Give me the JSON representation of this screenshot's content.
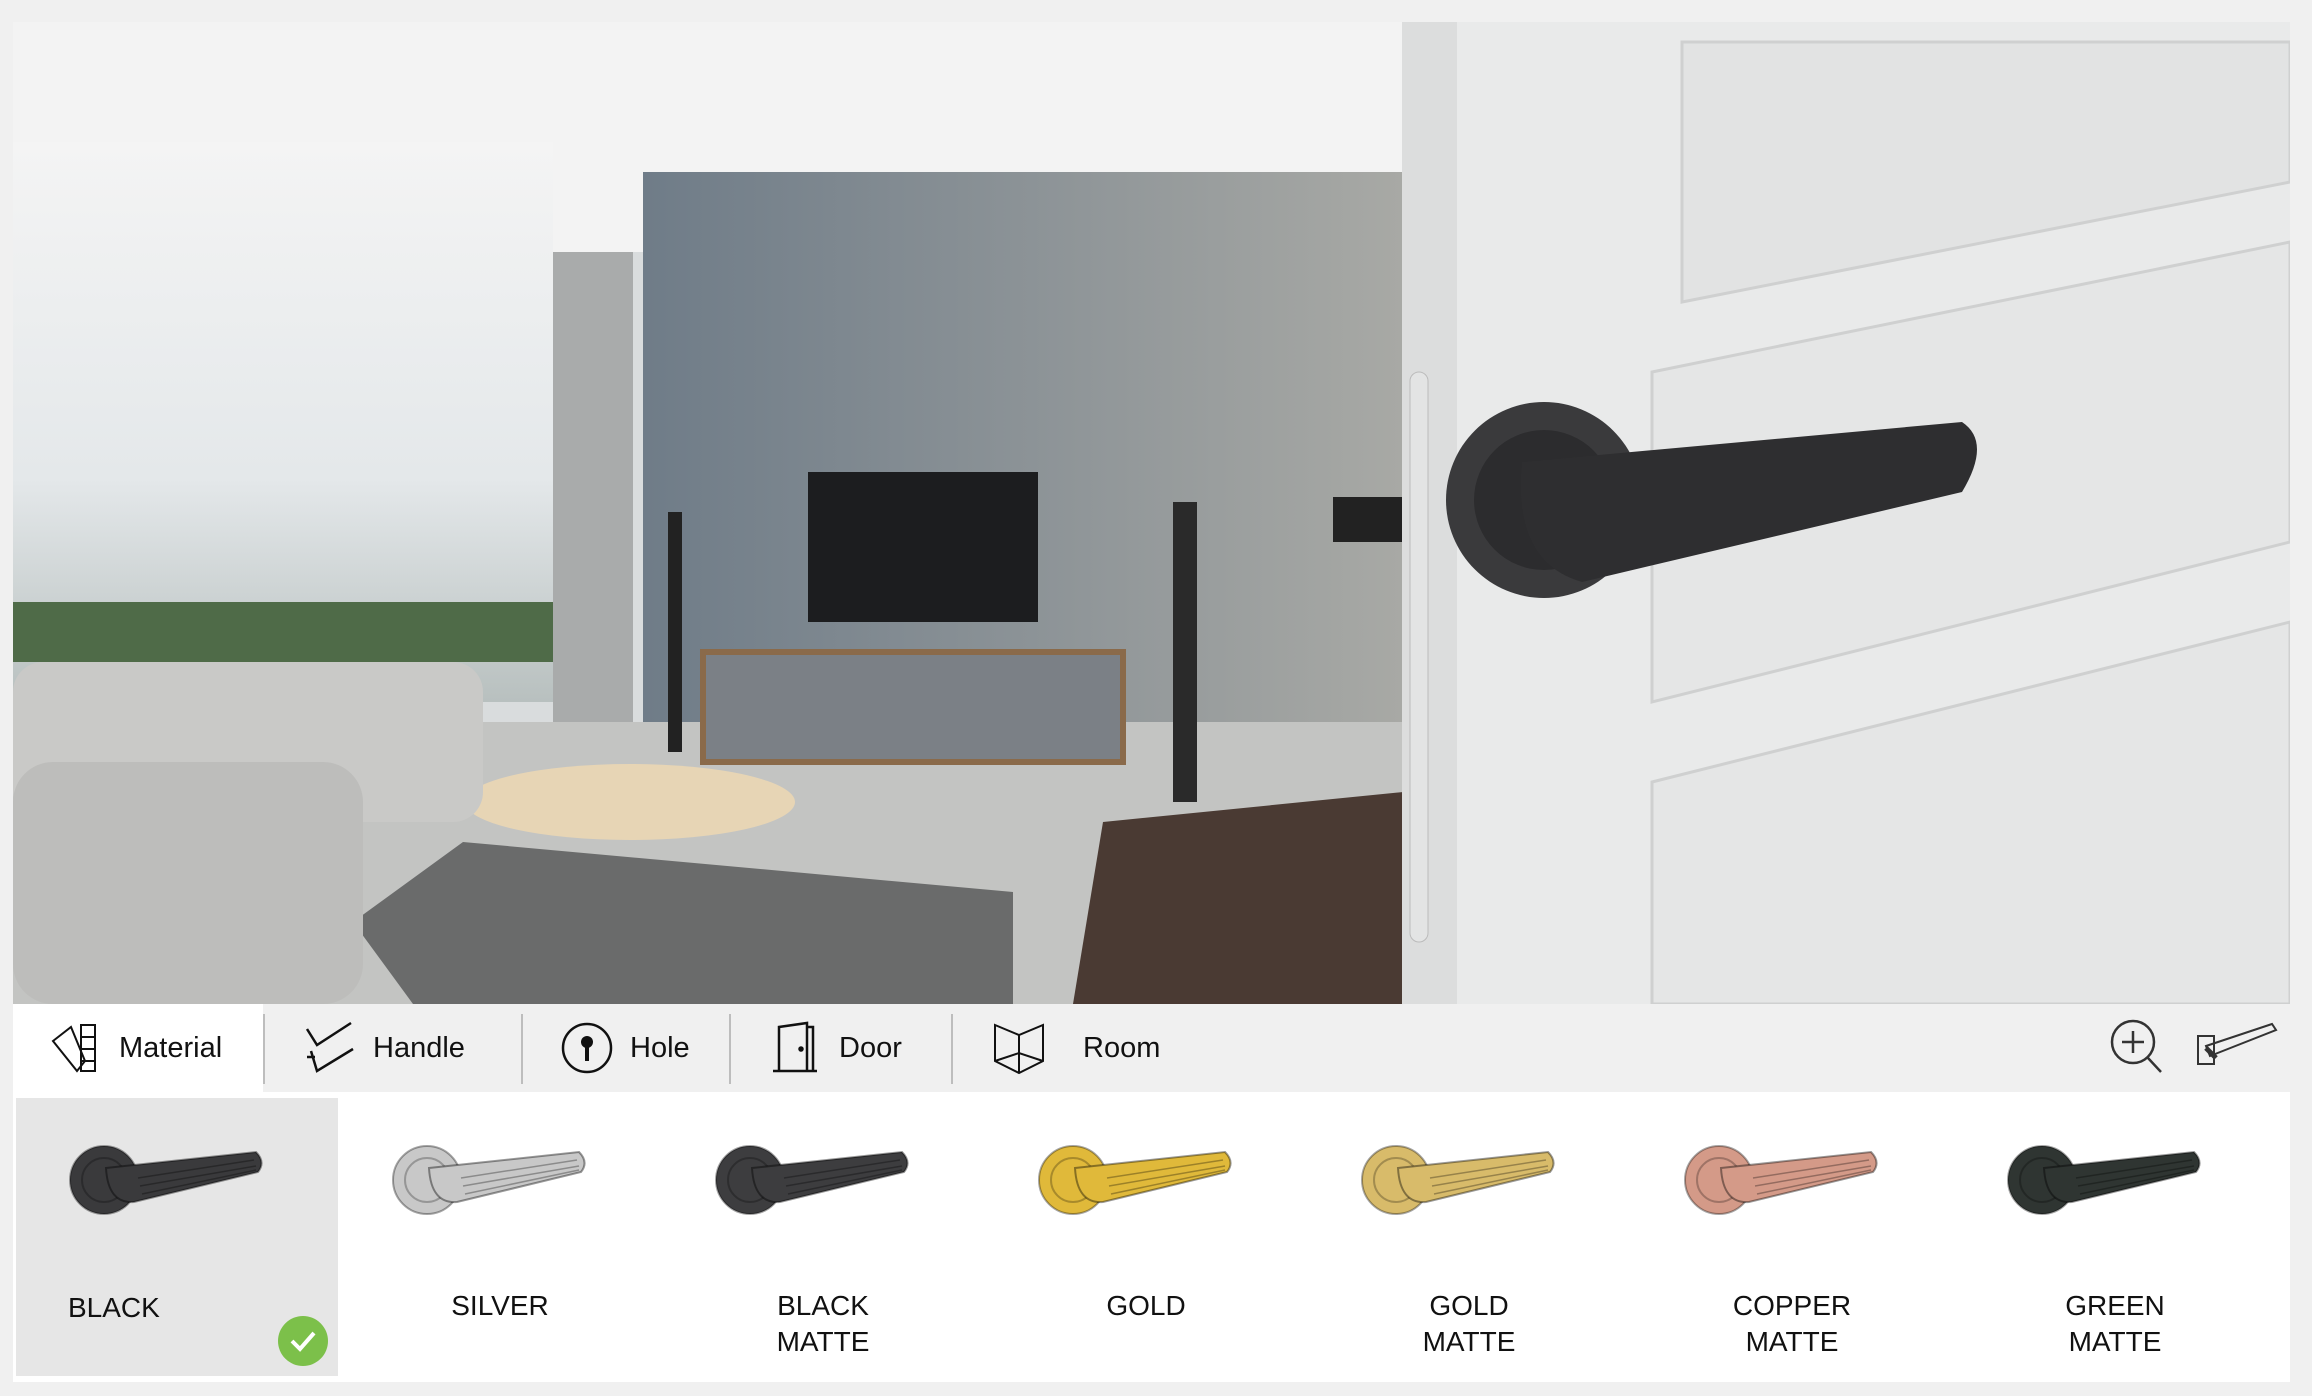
{
  "tabs": [
    {
      "label": "Material",
      "icon": "material-swatch-icon"
    },
    {
      "label": "Handle",
      "icon": "handle-icon"
    },
    {
      "label": "Hole",
      "icon": "keyhole-icon"
    },
    {
      "label": "Door",
      "icon": "door-icon"
    },
    {
      "label": "Room",
      "icon": "room-icon"
    }
  ],
  "tools": {
    "zoom_icon": "zoom-in-icon",
    "handle_view_icon": "handle-view-icon"
  },
  "swatches": [
    {
      "label": "BLACK",
      "color": "#3a3a3c",
      "selected": true
    },
    {
      "label": "SILVER",
      "color": "#c8c8c8",
      "selected": false
    },
    {
      "label": "BLACK\nMATTE",
      "color": "#3d3d3f",
      "selected": false
    },
    {
      "label": "GOLD",
      "color": "#e0b93a",
      "selected": false
    },
    {
      "label": "GOLD\nMATTE",
      "color": "#d8bb6a",
      "selected": false
    },
    {
      "label": "COPPER\nMATTE",
      "color": "#d49a88",
      "selected": false
    },
    {
      "label": "GREEN\nMATTE",
      "color": "#2f3532",
      "selected": false
    }
  ],
  "colors": {
    "selected_check": "#7cc04a",
    "selected_bg": "#e6e6e6",
    "background": "#f0f0f0"
  }
}
